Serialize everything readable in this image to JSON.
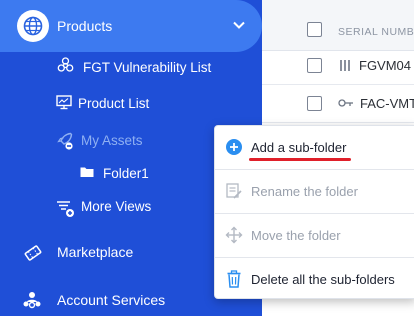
{
  "sidebar": {
    "products": {
      "label": "Products"
    },
    "items": [
      {
        "label": "FGT Vulnerability List",
        "icon": "biohazard-icon"
      },
      {
        "label": "Product List",
        "icon": "monitor-icon"
      },
      {
        "label": "My Assets",
        "icon": "rocket-icon"
      },
      {
        "label": "Folder1",
        "icon": "folder-icon"
      },
      {
        "label": "More Views",
        "icon": "list-plus-icon"
      }
    ],
    "marketplace": {
      "label": "Marketplace"
    },
    "account_services": {
      "label": "Account Services"
    }
  },
  "table": {
    "header": {
      "serial_label": "SERIAL NUMB"
    },
    "rows": [
      {
        "serial": "FGVM04"
      },
      {
        "serial": "FAC-VMT"
      }
    ]
  },
  "context_menu": {
    "items": [
      {
        "label": "Add a sub-folder",
        "icon": "plus-circle-icon",
        "enabled": true
      },
      {
        "label": "Rename the folder",
        "icon": "rename-icon",
        "enabled": false
      },
      {
        "label": "Move the folder",
        "icon": "move-icon",
        "enabled": false
      },
      {
        "label": "Delete all the sub-folders",
        "icon": "trash-icon",
        "enabled": true
      }
    ]
  },
  "colors": {
    "sidebar_bg": "#1f4fd7",
    "active_bg": "#3d7af0",
    "accent_blue": "#2a8ef0",
    "highlight_red": "#e0202a"
  }
}
